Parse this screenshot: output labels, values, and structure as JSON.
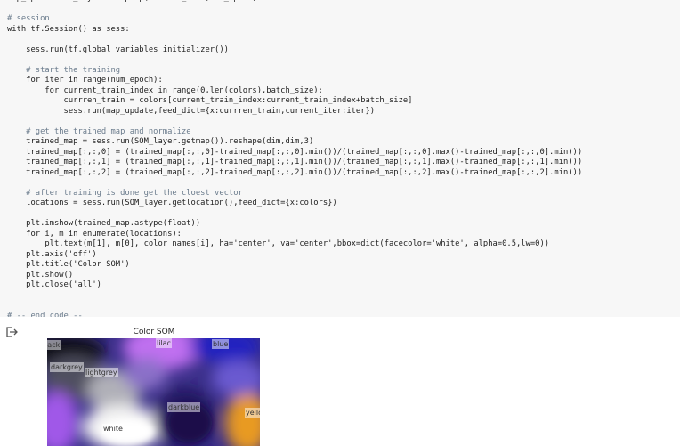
{
  "code_cell": {
    "lines": [
      {
        "text": "map_update=SOM_layer.backprop(current_iter,num_epoch)",
        "kind": "code"
      },
      {
        "text": "",
        "kind": "code"
      },
      {
        "text": "# session",
        "kind": "comment"
      },
      {
        "text": "with tf.Session() as sess:",
        "kind": "code"
      },
      {
        "text": "",
        "kind": "code"
      },
      {
        "text": "    sess.run(tf.global_variables_initializer())",
        "kind": "code"
      },
      {
        "text": "",
        "kind": "code"
      },
      {
        "text": "    # start the training",
        "kind": "comment"
      },
      {
        "text": "    for iter in range(num_epoch):",
        "kind": "code"
      },
      {
        "text": "        for current_train_index in range(0,len(colors),batch_size):",
        "kind": "code"
      },
      {
        "text": "            currren_train = colors[current_train_index:current_train_index+batch_size]",
        "kind": "code"
      },
      {
        "text": "            sess.run(map_update,feed_dict={x:currren_train,current_iter:iter})",
        "kind": "code"
      },
      {
        "text": "",
        "kind": "code"
      },
      {
        "text": "    # get the trained map and normalize",
        "kind": "comment"
      },
      {
        "text": "    trained_map = sess.run(SOM_layer.getmap()).reshape(dim,dim,3)",
        "kind": "code"
      },
      {
        "text": "    trained_map[:,:,0] = (trained_map[:,:,0]-trained_map[:,:,0].min())/(trained_map[:,:,0].max()-trained_map[:,:,0].min())",
        "kind": "code"
      },
      {
        "text": "    trained_map[:,:,1] = (trained_map[:,:,1]-trained_map[:,:,1].min())/(trained_map[:,:,1].max()-trained_map[:,:,1].min())",
        "kind": "code"
      },
      {
        "text": "    trained_map[:,:,2] = (trained_map[:,:,2]-trained_map[:,:,2].min())/(trained_map[:,:,2].max()-trained_map[:,:,2].min())",
        "kind": "code"
      },
      {
        "text": "",
        "kind": "code"
      },
      {
        "text": "    # after training is done get the cloest vector",
        "kind": "comment"
      },
      {
        "text": "    locations = sess.run(SOM_layer.getlocation(),feed_dict={x:colors})",
        "kind": "code"
      },
      {
        "text": "",
        "kind": "code"
      },
      {
        "text": "    plt.imshow(trained_map.astype(float))",
        "kind": "code"
      },
      {
        "text": "    for i, m in enumerate(locations):",
        "kind": "code"
      },
      {
        "text": "        plt.text(m[1], m[0], color_names[i], ha='center', va='center',bbox=dict(facecolor='white', alpha=0.5,lw=0))",
        "kind": "code"
      },
      {
        "text": "    plt.axis('off')",
        "kind": "code"
      },
      {
        "text": "    plt.title('Color SOM')",
        "kind": "code"
      },
      {
        "text": "    plt.show()",
        "kind": "code"
      },
      {
        "text": "    plt.close('all')",
        "kind": "code"
      },
      {
        "text": "",
        "kind": "code"
      },
      {
        "text": "",
        "kind": "code"
      },
      {
        "text": "# -- end code --",
        "kind": "comment"
      }
    ]
  },
  "output": {
    "icon": "output-redirect-icon",
    "figure_title": "Color SOM",
    "som_labels": {
      "black": "black",
      "lilac": "lilac",
      "blue": "blue",
      "darkgrey": "darkgrey",
      "lightgrey": "lightgrey",
      "darkblue": "darkblue",
      "yellow": "yellow",
      "white": "white"
    }
  },
  "colors": {
    "code_bg": "#f7f7f7",
    "comment": "#6a7b8c",
    "purple": "#a060e0",
    "navy": "#2a1f7a",
    "orange": "#e09020"
  }
}
